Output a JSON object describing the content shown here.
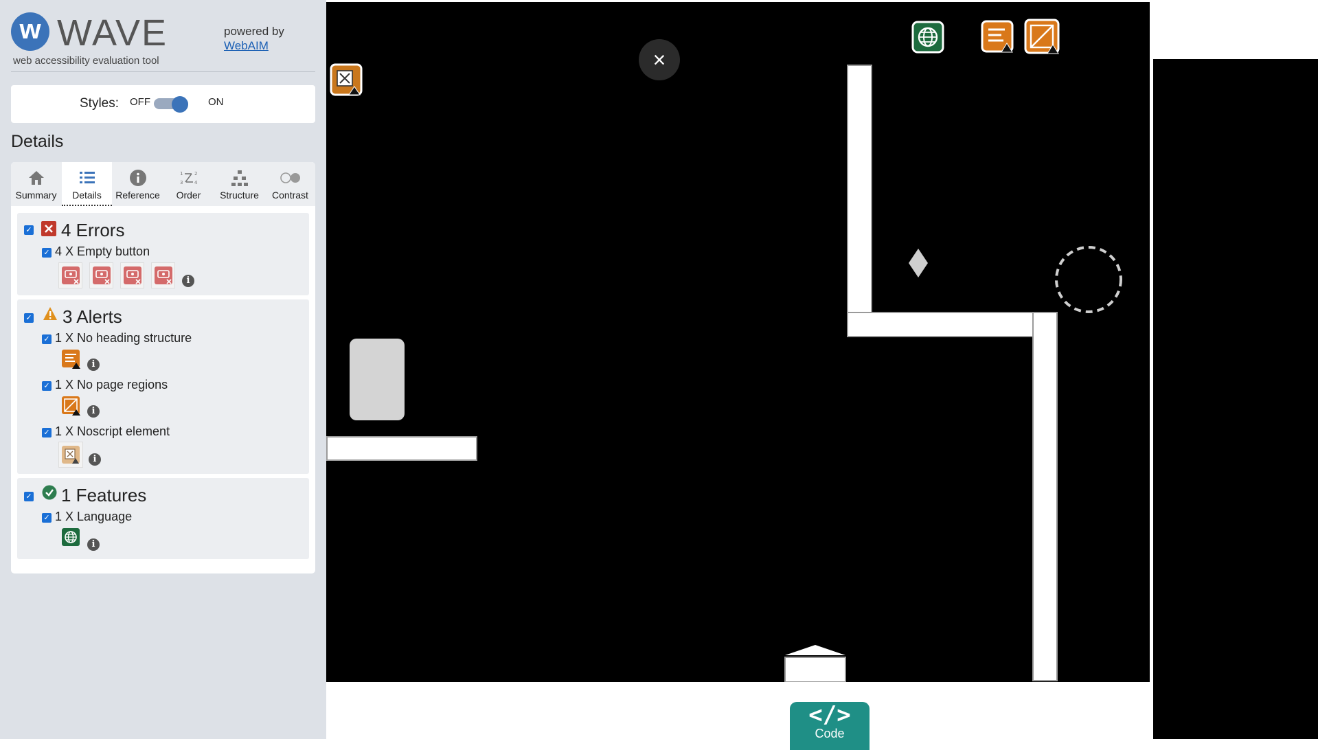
{
  "wave": {
    "logo_letter": "w",
    "logo_word": "WAVE",
    "tagline": "web accessibility evaluation tool",
    "powered_by": "powered by",
    "webaim_link": "WebAIM",
    "styles_label": "Styles:",
    "styles_off": "OFF",
    "styles_on": "ON",
    "styles_enabled": true,
    "details_heading": "Details",
    "tabs": [
      {
        "label": "Summary",
        "icon": "home-icon",
        "active": false
      },
      {
        "label": "Details",
        "icon": "list-icon",
        "active": true
      },
      {
        "label": "Reference",
        "icon": "info-icon",
        "active": false
      },
      {
        "label": "Order",
        "icon": "order-icon",
        "active": false
      },
      {
        "label": "Structure",
        "icon": "structure-icon",
        "active": false
      },
      {
        "label": "Contrast",
        "icon": "contrast-icon",
        "active": false
      }
    ],
    "errors": {
      "title": "4 Errors",
      "color": "#c0392b",
      "items": [
        {
          "label": "4 X Empty button",
          "count": 4
        }
      ]
    },
    "alerts": {
      "title": "3 Alerts",
      "color": "#e0901d",
      "items": [
        {
          "label": "1 X No heading structure",
          "count": 1
        },
        {
          "label": "1 X No page regions",
          "count": 1
        },
        {
          "label": "1 X Noscript element",
          "count": 1
        }
      ]
    },
    "features": {
      "title": "1 Features",
      "color": "#2e7d4f",
      "items": [
        {
          "label": "1 X Language",
          "count": 1
        }
      ]
    },
    "info_glyph": "i"
  },
  "stage": {
    "close_glyph": "×",
    "code_glyph": "</>",
    "code_label": "Code",
    "background": "#000000"
  },
  "colors": {
    "sidebar_bg": "#dde1e7",
    "accent_blue": "#3b73b9",
    "code_teal": "#1f8f86",
    "alert_orange": "#d9781a",
    "feature_green": "#1d6b3e"
  }
}
